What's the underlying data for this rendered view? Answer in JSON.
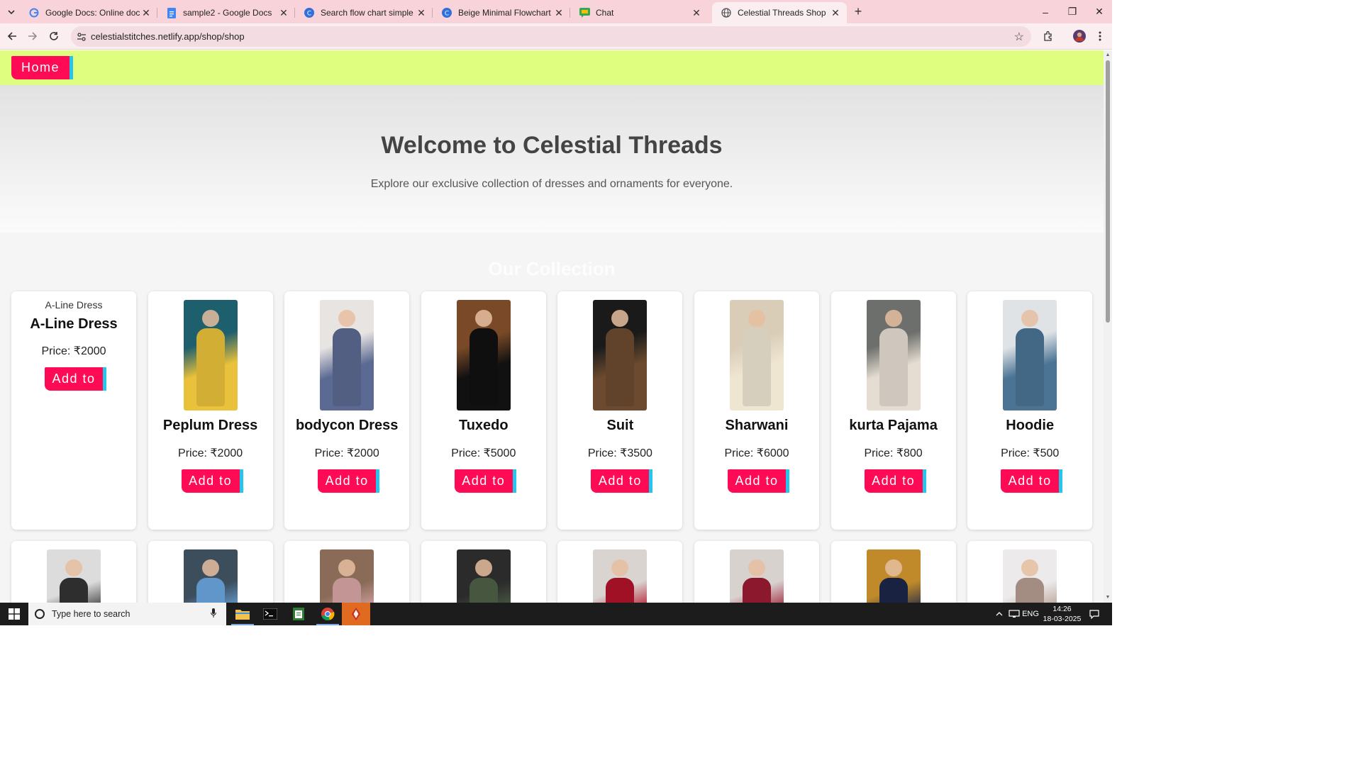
{
  "browser": {
    "tabs": [
      {
        "title": "Google Docs: Online document",
        "icon": "google-g-icon",
        "active": false
      },
      {
        "title": "sample2 - Google Docs",
        "icon": "google-docs-icon",
        "active": false
      },
      {
        "title": "Search flow chart simple free - ",
        "icon": "canva-icon",
        "active": false
      },
      {
        "title": "Beige Minimal Flowchart Infogr",
        "icon": "canva-icon",
        "active": false
      },
      {
        "title": "Chat",
        "icon": "google-chat-icon",
        "active": false
      },
      {
        "title": "Celestial Threads Shop",
        "icon": "globe-icon",
        "active": true
      }
    ],
    "url": "celestialstitches.netlify.app/shop/shop",
    "new_tab": "+",
    "window_controls": {
      "minimize": "–",
      "restore": "❐",
      "close": "✕"
    }
  },
  "site": {
    "nav": {
      "home_label": "Home"
    },
    "hero": {
      "title": "Welcome to Celestial Threads",
      "subtitle": "Explore our exclusive collection of dresses and ornaments for everyone."
    },
    "collection_title": "Our Collection",
    "add_label": "Add to",
    "products": [
      {
        "name": "A-Line Dress",
        "price": "Price: ₹2000",
        "image": "broken",
        "alt": "A-Line Dress",
        "colors": [
          "#ffffff",
          "#ffffff"
        ]
      },
      {
        "name": "Peplum Dress",
        "price": "Price: ₹2000",
        "image": "photo",
        "colors": [
          "#1e5f6e",
          "#e9c13a"
        ]
      },
      {
        "name": "bodycon Dress",
        "price": "Price: ₹2000",
        "image": "photo",
        "colors": [
          "#e8e4e2",
          "#5b6a92"
        ]
      },
      {
        "name": "Tuxedo",
        "price": "Price: ₹5000",
        "image": "photo",
        "colors": [
          "#7a4a28",
          "#111111"
        ]
      },
      {
        "name": "Suit",
        "price": "Price: ₹3500",
        "image": "photo",
        "colors": [
          "#1a1a1a",
          "#6b4a2f"
        ]
      },
      {
        "name": "Sharwani",
        "price": "Price: ₹6000",
        "image": "photo",
        "colors": [
          "#d9cdb8",
          "#efe6d2"
        ]
      },
      {
        "name": "kurta Pajama",
        "price": "Price: ₹800",
        "image": "photo",
        "colors": [
          "#6d6f6c",
          "#e6ddd2"
        ]
      },
      {
        "name": "Hoodie",
        "price": "Price: ₹500",
        "image": "photo",
        "colors": [
          "#dfe3e6",
          "#4a7394"
        ]
      }
    ],
    "second_row": [
      {
        "colors": [
          "#dcdcdc",
          "#333333"
        ],
        "image": "photo"
      },
      {
        "colors": [
          "#3c4d5c",
          "#6ba7e0"
        ],
        "image": "photo"
      },
      {
        "colors": [
          "#8a6b58",
          "#d9a6a6"
        ],
        "image": "photo"
      },
      {
        "colors": [
          "#2b2b2b",
          "#4f5f46"
        ],
        "image": "photo"
      },
      {
        "colors": [
          "#d9d4d0",
          "#b3132a"
        ],
        "image": "photo"
      },
      {
        "colors": [
          "#d8d2cf",
          "#9c1b33"
        ],
        "image": "photo"
      },
      {
        "colors": [
          "#c08a2a",
          "#1c2647"
        ],
        "image": "photo"
      },
      {
        "colors": [
          "#eceaea",
          "#b59b8f"
        ],
        "image": "photo"
      }
    ]
  },
  "taskbar": {
    "search_placeholder": "Type here to search",
    "language": "ENG",
    "time": "14:26",
    "date": "18-03-2025"
  }
}
